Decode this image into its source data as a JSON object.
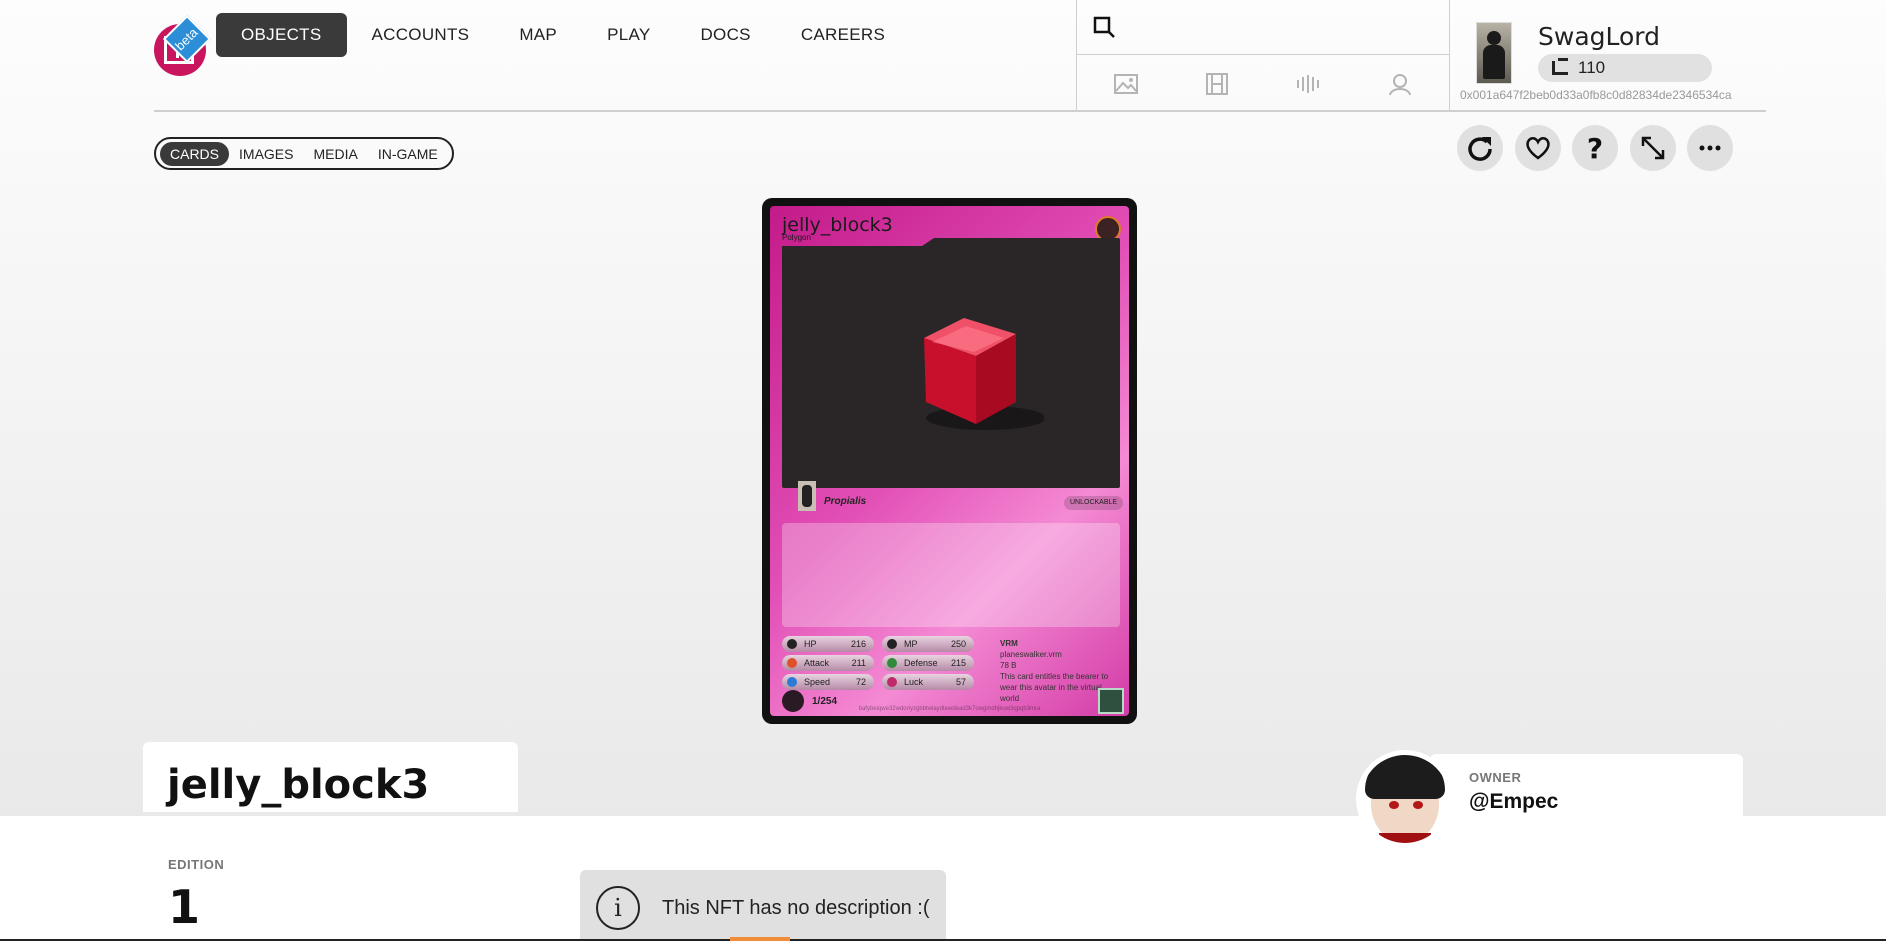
{
  "nav": {
    "logo_badge": "beta",
    "items": [
      {
        "label": "OBJECTS",
        "active": true
      },
      {
        "label": "ACCOUNTS",
        "active": false
      },
      {
        "label": "MAP",
        "active": false
      },
      {
        "label": "PLAY",
        "active": false
      },
      {
        "label": "DOCS",
        "active": false
      },
      {
        "label": "CAREERS",
        "active": false
      }
    ]
  },
  "search": {
    "placeholder": "",
    "filters": [
      "image-icon",
      "film-icon",
      "audio-icon",
      "avatar-icon"
    ]
  },
  "user": {
    "name": "SwagLord",
    "balance": "110",
    "address": "0x001a647f2beb0d33a0fb8c0d82834de2346534ca"
  },
  "view_tabs": [
    {
      "label": "CARDS",
      "active": true
    },
    {
      "label": "IMAGES",
      "active": false
    },
    {
      "label": "MEDIA",
      "active": false
    },
    {
      "label": "IN-GAME",
      "active": false
    }
  ],
  "actions": [
    "refresh-icon",
    "heart-icon",
    "help-icon",
    "expand-icon",
    "more-icon"
  ],
  "card": {
    "title": "jelly_block3",
    "subtitle": "Polygon",
    "creator": "Propialis",
    "unlock_badge": "UNLOCKABLE",
    "stats": [
      {
        "name": "HP",
        "value": "216",
        "color": "#222222"
      },
      {
        "name": "MP",
        "value": "250",
        "color": "#222222"
      },
      {
        "name": "Attack",
        "value": "211",
        "color": "#e0502a"
      },
      {
        "name": "Defense",
        "value": "215",
        "color": "#2f8a3a"
      },
      {
        "name": "Speed",
        "value": "72",
        "color": "#2a7ad6"
      },
      {
        "name": "Luck",
        "value": "57",
        "color": "#c02a6a"
      }
    ],
    "vrm_title": "VRM",
    "vrm_file": "planeswalker.vrm",
    "vrm_size": "78 B",
    "vrm_note": "This card entitles the bearer to wear this avatar in the virtual world",
    "edition": "1/254",
    "hash": "bafybeiqwe32wdoriyzgbbtwlaydtewdead3k7owgmdhjkuw3qpqb3mra",
    "accent": "#e24fb6"
  },
  "object": {
    "title": "jelly_block3",
    "edition_label": "EDITION",
    "edition_value": "1",
    "no_description": "This NFT has no description :(",
    "owner_label": "OWNER",
    "owner_name": "@Empec"
  }
}
